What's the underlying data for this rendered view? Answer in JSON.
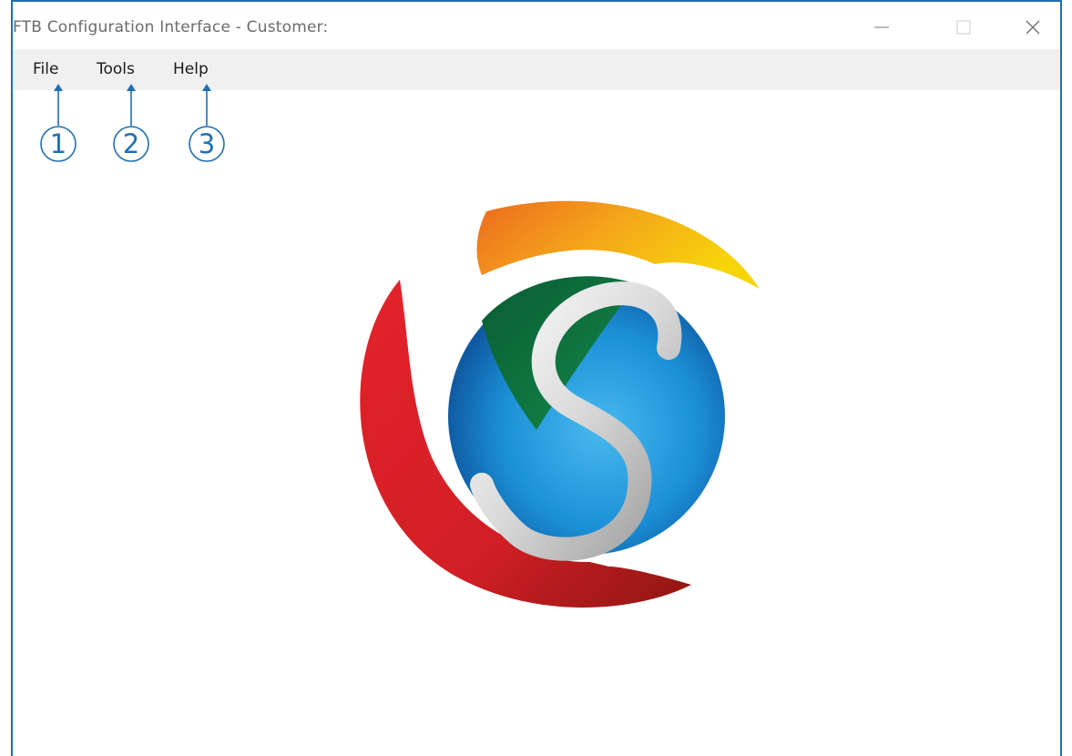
{
  "window": {
    "title": "FTB Configuration Interface - Customer:",
    "controls": [
      "minimize-icon",
      "maximize-icon",
      "close-icon"
    ]
  },
  "menubar": {
    "items": [
      {
        "label": "File"
      },
      {
        "label": "Tools"
      },
      {
        "label": "Help"
      }
    ]
  },
  "callouts": [
    "1",
    "2",
    "3"
  ],
  "colors": {
    "window_border": "#1f6fb2",
    "menubar_bg": "#f0f0f0",
    "callout": "#1f6fb2",
    "logo_red": "#e0202a",
    "logo_orange": "#f08a1c",
    "logo_yellow": "#f7cf0a",
    "logo_blue": "#1b8fd6",
    "logo_green": "#0a6a3a"
  }
}
